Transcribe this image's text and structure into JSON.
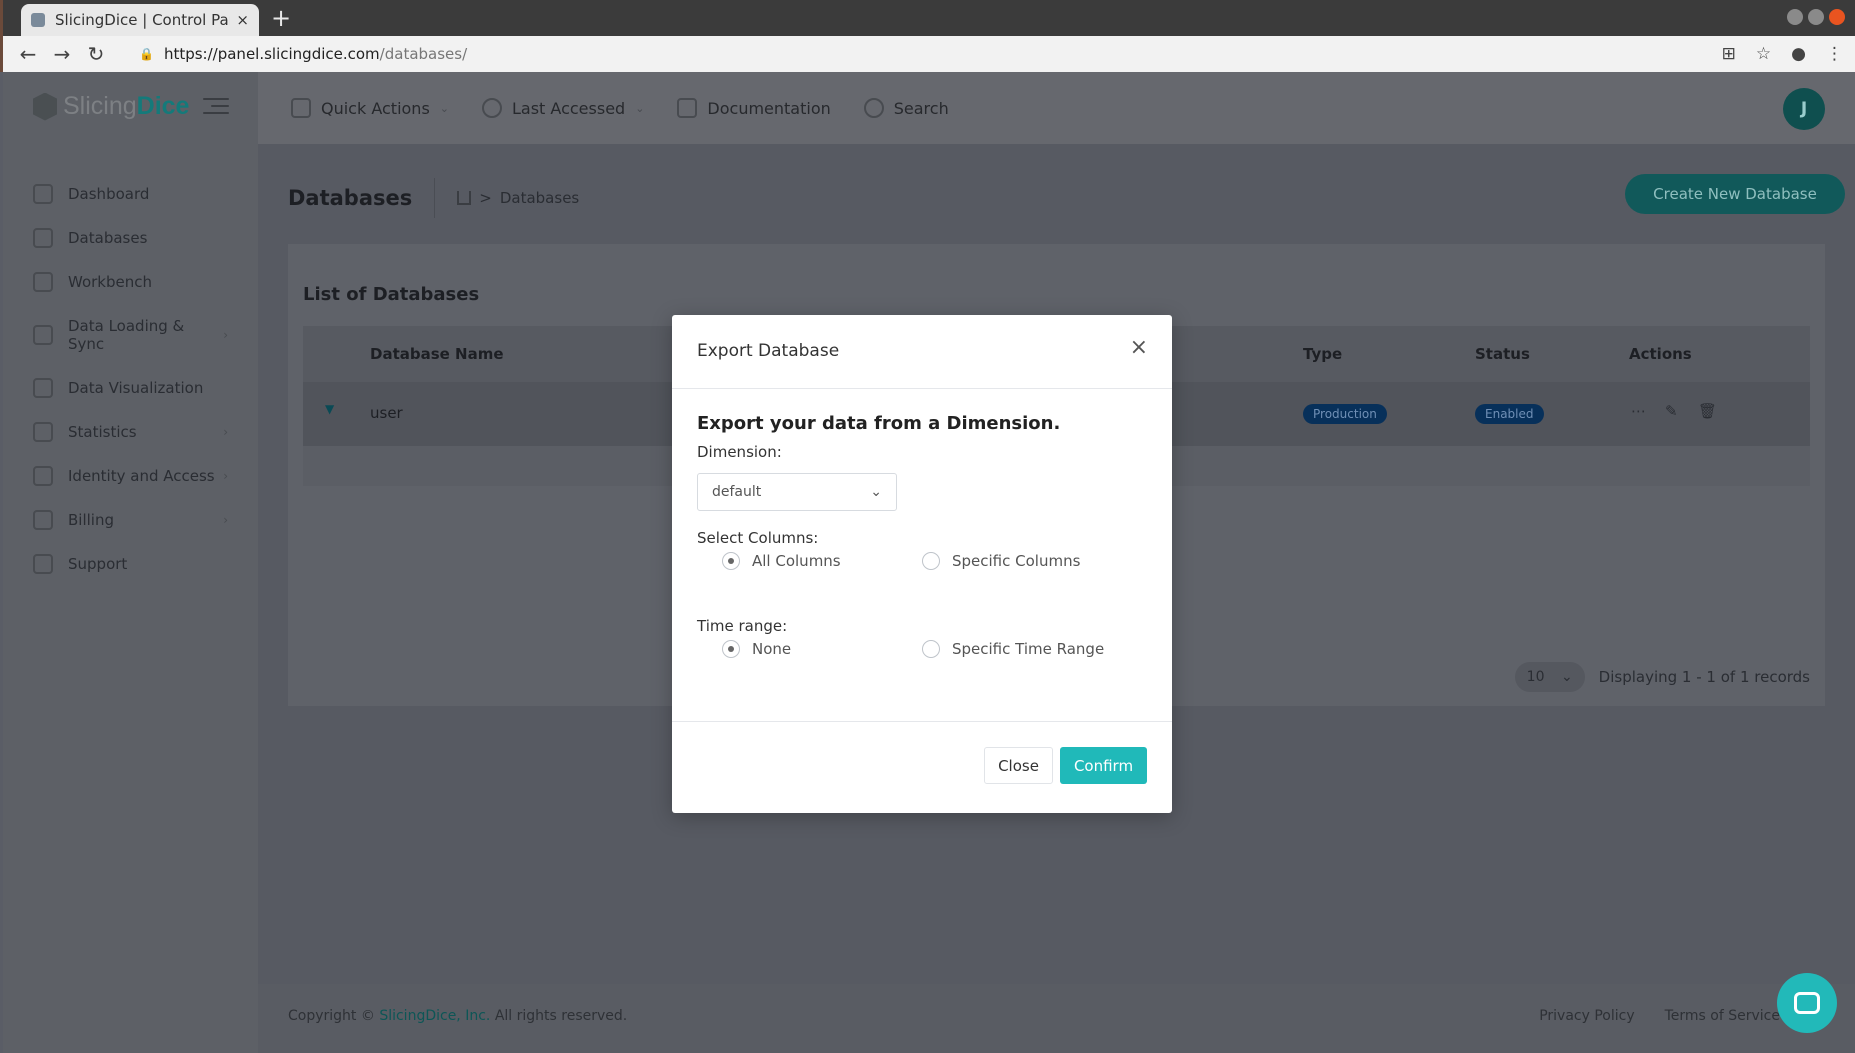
{
  "browser": {
    "tab_title": "SlicingDice | Control Panel",
    "tab_close": "×",
    "new_tab": "+",
    "url_host": "https://panel.slicingdice.com",
    "url_path": "/databases/"
  },
  "sidebar": {
    "logo_prefix": "Slicing",
    "logo_suffix": "Dice",
    "items": [
      {
        "label": "Dashboard",
        "chevron": ""
      },
      {
        "label": "Databases",
        "chevron": ""
      },
      {
        "label": "Workbench",
        "chevron": ""
      },
      {
        "label": "Data Loading & Sync",
        "chevron": "›"
      },
      {
        "label": "Data Visualization",
        "chevron": ""
      },
      {
        "label": "Statistics",
        "chevron": "›"
      },
      {
        "label": "Identity and Access",
        "chevron": "›"
      },
      {
        "label": "Billing",
        "chevron": "›"
      },
      {
        "label": "Support",
        "chevron": ""
      }
    ]
  },
  "topbar": {
    "quick_actions": "Quick Actions",
    "last_accessed": "Last Accessed",
    "documentation": "Documentation",
    "search": "Search",
    "avatar_initial": "J"
  },
  "page": {
    "title": "Databases",
    "breadcrumb": "Databases",
    "breadcrumb_sep": ">",
    "create_button": "Create New Database"
  },
  "list": {
    "title": "List of Databases",
    "columns": {
      "name": "Database Name",
      "type": "Type",
      "status": "Status",
      "actions": "Actions"
    },
    "rows": [
      {
        "name": "user",
        "type": "Production",
        "status": "Enabled"
      }
    ],
    "page_size": "10",
    "displaying": "Displaying 1 - 1 of 1 records"
  },
  "modal": {
    "title": "Export Database",
    "heading": "Export your data from a Dimension.",
    "dimension_label": "Dimension:",
    "dimension_value": "default",
    "columns_label": "Select Columns:",
    "columns_options": [
      "All Columns",
      "Specific Columns"
    ],
    "time_label": "Time range:",
    "time_options": [
      "None",
      "Specific Time Range"
    ],
    "close_button": "Close",
    "confirm_button": "Confirm"
  },
  "footer": {
    "copyright_prefix": "Copyright ©",
    "brand": "SlicingDice, Inc.",
    "copyright_suffix": "All rights reserved.",
    "privacy": "Privacy Policy",
    "terms": "Terms of Service"
  },
  "colors": {
    "accent": "#20b9b9",
    "badge": "#07305a"
  }
}
